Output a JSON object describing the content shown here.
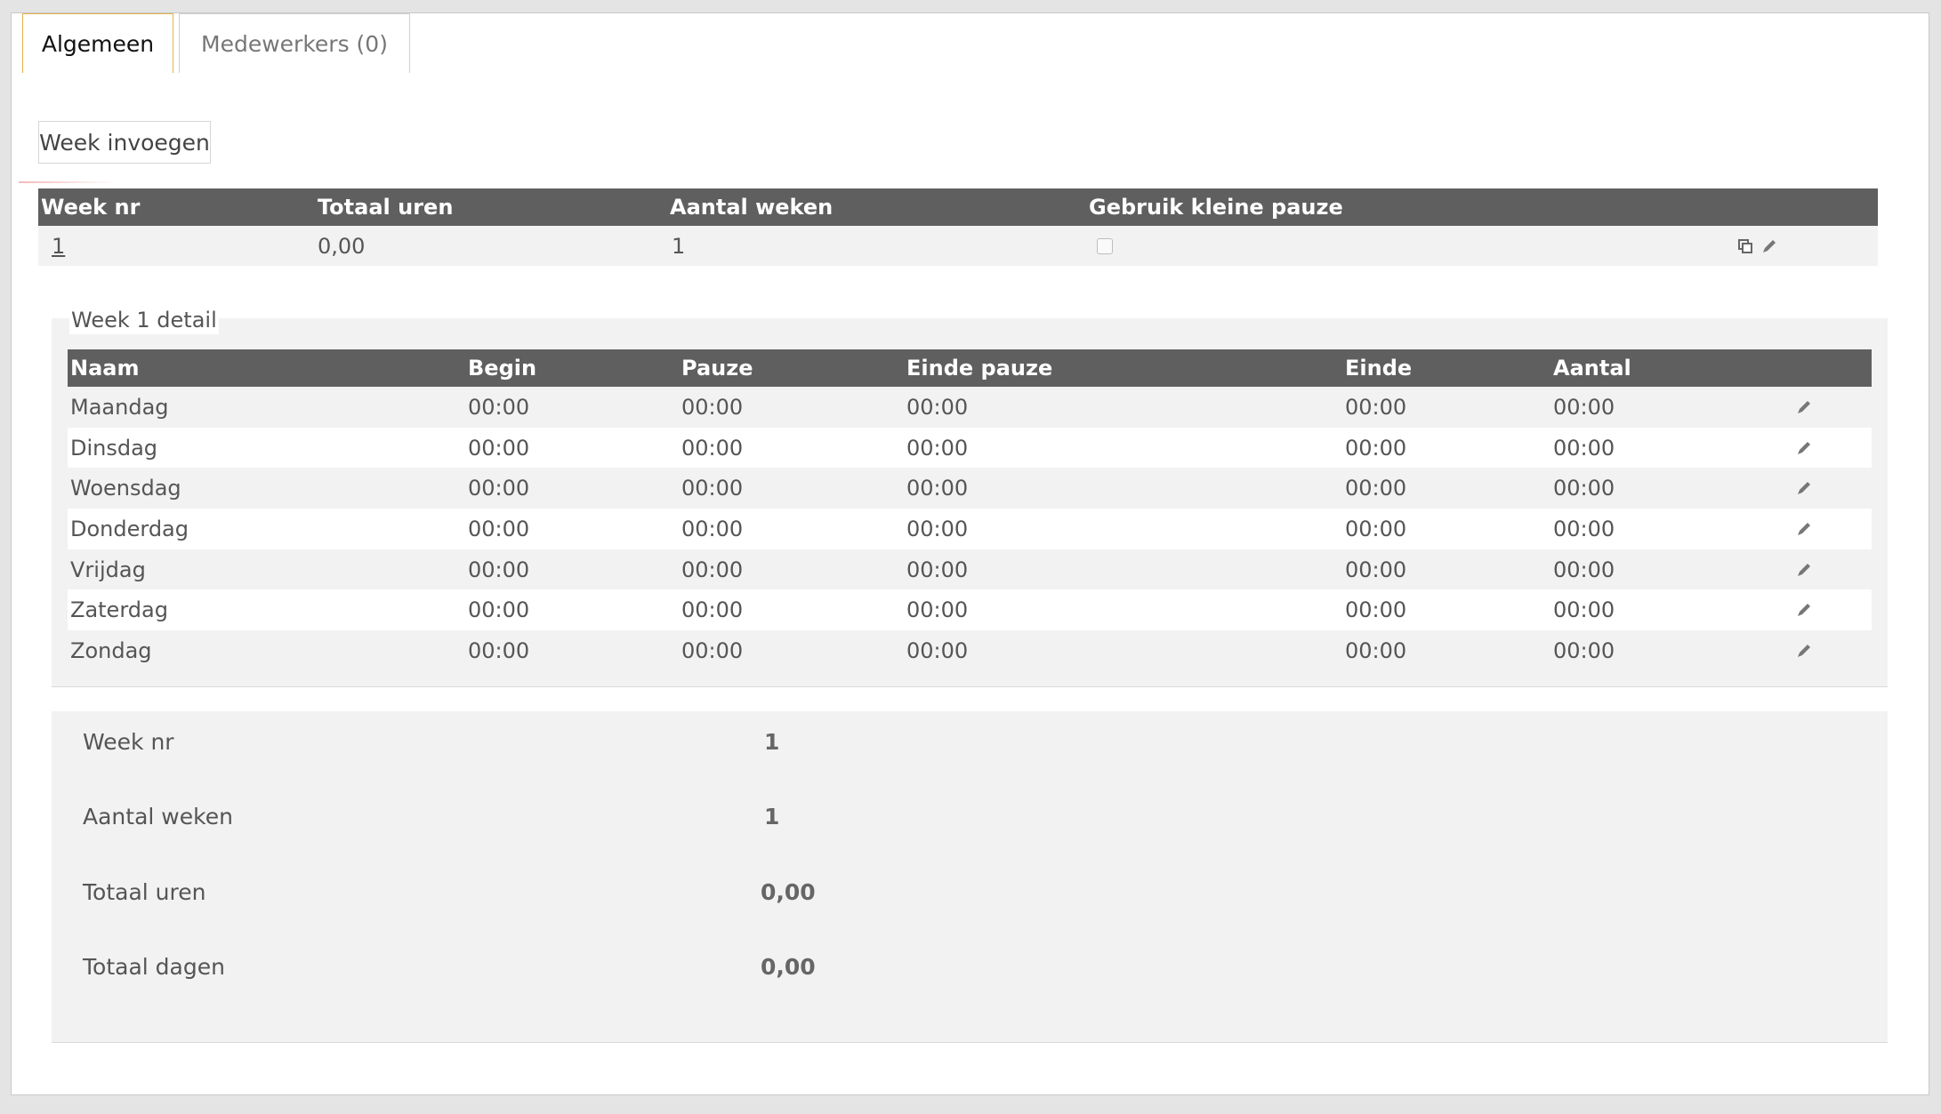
{
  "tabs": [
    {
      "label": "Algemeen",
      "active": true
    },
    {
      "label": "Medewerkers (0)",
      "active": false
    }
  ],
  "toolbar": {
    "week_insert_label": "Week invoegen"
  },
  "weeks_table": {
    "headers": [
      "Week nr",
      "Totaal uren",
      "Aantal weken",
      "Gebruik kleine pauze"
    ],
    "rows": [
      {
        "week_nr": "1",
        "totaal_uren": "0,00",
        "aantal_weken": "1",
        "kleine_pauze": false
      }
    ]
  },
  "detail": {
    "title": "Week 1 detail",
    "headers": [
      "Naam",
      "Begin",
      "Pauze",
      "Einde pauze",
      "Einde",
      "Aantal"
    ],
    "rows": [
      {
        "naam": "Maandag",
        "begin": "00:00",
        "pauze": "00:00",
        "einde_pauze": "00:00",
        "einde": "00:00",
        "aantal": "00:00"
      },
      {
        "naam": "Dinsdag",
        "begin": "00:00",
        "pauze": "00:00",
        "einde_pauze": "00:00",
        "einde": "00:00",
        "aantal": "00:00"
      },
      {
        "naam": "Woensdag",
        "begin": "00:00",
        "pauze": "00:00",
        "einde_pauze": "00:00",
        "einde": "00:00",
        "aantal": "00:00"
      },
      {
        "naam": "Donderdag",
        "begin": "00:00",
        "pauze": "00:00",
        "einde_pauze": "00:00",
        "einde": "00:00",
        "aantal": "00:00"
      },
      {
        "naam": "Vrijdag",
        "begin": "00:00",
        "pauze": "00:00",
        "einde_pauze": "00:00",
        "einde": "00:00",
        "aantal": "00:00"
      },
      {
        "naam": "Zaterdag",
        "begin": "00:00",
        "pauze": "00:00",
        "einde_pauze": "00:00",
        "einde": "00:00",
        "aantal": "00:00"
      },
      {
        "naam": "Zondag",
        "begin": "00:00",
        "pauze": "00:00",
        "einde_pauze": "00:00",
        "einde": "00:00",
        "aantal": "00:00"
      }
    ]
  },
  "summary": {
    "week_nr_label": "Week nr",
    "week_nr_value": "1",
    "aantal_weken_label": "Aantal weken",
    "aantal_weken_value": "1",
    "totaal_uren_label": "Totaal uren",
    "totaal_uren_value": "0,00",
    "totaal_dagen_label": "Totaal dagen",
    "totaal_dagen_value": "0,00"
  },
  "icons": {
    "copy": "copy-icon",
    "edit": "pencil-icon"
  },
  "colors": {
    "header_bg": "#5f5f5f",
    "active_tab_border": "#e6b44a"
  }
}
